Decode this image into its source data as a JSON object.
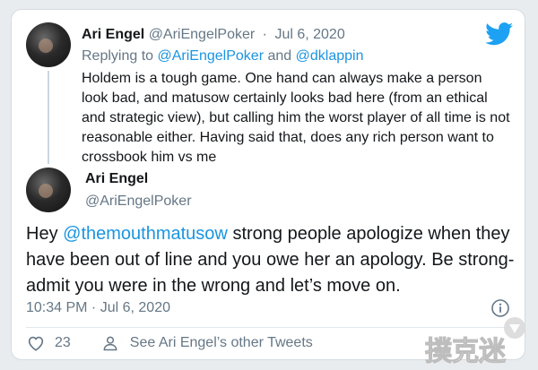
{
  "tweet1": {
    "name": "Ari Engel",
    "handle": "@AriEngelPoker",
    "date": "Jul 6, 2020",
    "replying_prefix": "Replying to",
    "replying_mention_1": "@AriEngelPoker",
    "replying_and": "and",
    "replying_mention_2": "@dklappin",
    "text": "Holdem is a tough game. One hand can always make a person look bad, and matusow certainly looks bad here (from an ethical and strategic view), but calling him the worst player of all time is not reasonable either. Having said that, does any rich person want to crossbook him vs me"
  },
  "tweet2": {
    "name": "Ari Engel",
    "handle": "@AriEngelPoker",
    "text_before": "Hey",
    "mention": "@themouthmatusow",
    "text_after": "strong people apologize when they have been out of line and you owe her an apology. Be strong- admit you were in the wrong and let’s move on.",
    "timestamp": "10:34 PM · Jul 6, 2020",
    "like_count": "23",
    "other_tweets_label": "See Ari Engel’s other Tweets"
  },
  "watermark_text": "撲克迷",
  "colors": {
    "accent": "#1da1f2",
    "mention": "#1b95e0",
    "secondary_text": "#657786",
    "primary_text": "#14171a"
  },
  "icons": {
    "logo": "twitter-bird-icon",
    "info": "info-icon",
    "like": "heart-icon",
    "profile": "person-icon"
  }
}
